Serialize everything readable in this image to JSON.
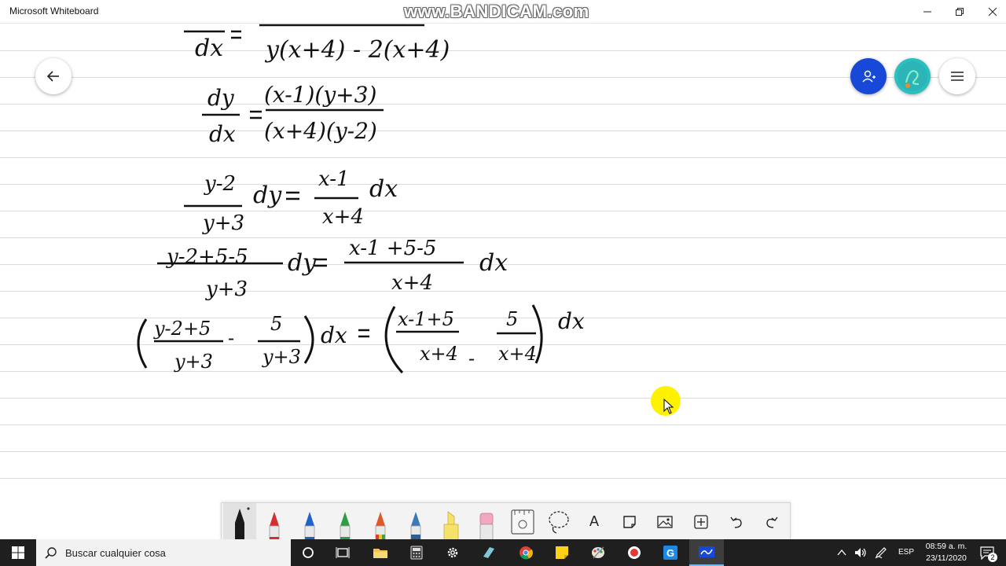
{
  "window": {
    "title": "Microsoft Whiteboard",
    "watermark": "www.BANDICAM.com"
  },
  "canvas": {
    "grid": "ruled-lines"
  },
  "math": {
    "line1": {
      "lhs": "dx",
      "denominator": "y(x+4) - 2(x+4)"
    },
    "line2": {
      "lhs_num": "dy",
      "lhs_den": "dx",
      "rhs_num": "(x-1)(y+3)",
      "rhs_den": "(x+4)(y-2)"
    },
    "line3": {
      "lhs_num": "y-2",
      "lhs_den": "y+3",
      "lhs_diff": "dy",
      "rhs_num": "x-1",
      "rhs_den": "x+4",
      "rhs_diff": "dx"
    },
    "line4": {
      "lhs_num": "y-2+5-5",
      "lhs_den": "y+3",
      "lhs_diff": "dy",
      "rhs_num": "x-1 +5-5",
      "rhs_den": "x+4",
      "rhs_diff": "dx"
    },
    "line5": {
      "a_num": "y-2+5",
      "a_den": "y+3",
      "minus": "-",
      "b_num": "5",
      "b_den": "y+3",
      "lhs_diff": "dx",
      "c_num": "x-1+5",
      "c_den": "x+4",
      "d_num": "5",
      "d_den": "x+4",
      "rhs_diff": "dx"
    }
  },
  "toolbar": {
    "tools": [
      "pen-black",
      "pen-red",
      "pen-blue",
      "pen-green",
      "pen-rainbow",
      "pen-galaxy",
      "highlighter",
      "eraser",
      "ruler",
      "lasso",
      "text",
      "note",
      "image",
      "add",
      "undo",
      "redo"
    ],
    "text_tool_label": "A",
    "colors": {
      "black": "#1a1a1a",
      "red": "#d32f2f",
      "blue": "#1e64c8",
      "green": "#2e9d46",
      "highlighter": "#f6e26a",
      "eraser": "#f4a7c0"
    }
  },
  "taskbar": {
    "search_placeholder": "Buscar cualquier cosa",
    "language": "ESP",
    "time": "08:59 a. m.",
    "date": "23/11/2020",
    "notifications": "2"
  },
  "colors": {
    "accent": "#1848d8",
    "highlight": "#fff200",
    "taskbar": "#1f1f1f"
  }
}
